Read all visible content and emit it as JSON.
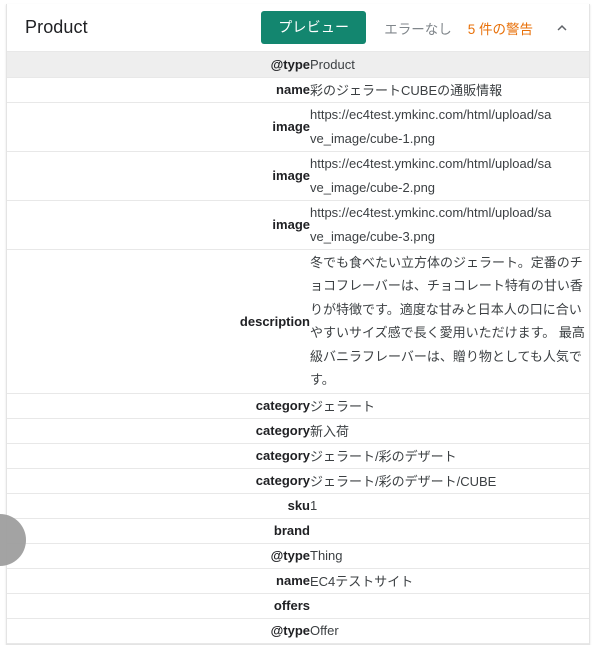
{
  "header": {
    "title": "Product",
    "preview_label": "プレビュー",
    "errors_label": "エラーなし",
    "warnings_label": "5 件の警告",
    "collapse_icon": "chevron-up-icon",
    "accent_color": "#13866f",
    "warning_color": "#e8710a",
    "error_text_color": "#80868b"
  },
  "table": {
    "rows": [
      {
        "key": "@type",
        "level": 1,
        "value": "Product",
        "shaded": true,
        "lines": 1
      },
      {
        "key": "name",
        "level": 1,
        "value": "彩のジェラートCUBEの通販情報",
        "shaded": false,
        "lines": 1
      },
      {
        "key": "image",
        "level": 1,
        "value": "https://ec4test.ymkinc.com/html/upload/save_image/cube-1.png",
        "value_line1": "https://ec4test.ymkinc.com/html/upload/sa",
        "value_line2": "ve_image/cube-1.png",
        "shaded": false,
        "lines": 2
      },
      {
        "key": "image",
        "level": 1,
        "value": "https://ec4test.ymkinc.com/html/upload/save_image/cube-2.png",
        "value_line1": "https://ec4test.ymkinc.com/html/upload/sa",
        "value_line2": "ve_image/cube-2.png",
        "shaded": false,
        "lines": 2
      },
      {
        "key": "image",
        "level": 1,
        "value": "https://ec4test.ymkinc.com/html/upload/save_image/cube-3.png",
        "value_line1": "https://ec4test.ymkinc.com/html/upload/sa",
        "value_line2": "ve_image/cube-3.png",
        "shaded": false,
        "lines": 2
      },
      {
        "key": "description",
        "level": 1,
        "value": "冬でも食べたい立方体のジェラート。定番のチョコフレーバーは、チョコレート特有の甘い香りが特徴です。適度な甘みと日本人の口に合いやすいサイズ感で長く愛用いただけます。 最高級バニラフレーバーは、贈り物としても人気です。",
        "shaded": false,
        "lines": 6
      },
      {
        "key": "category",
        "level": 1,
        "value": "ジェラート",
        "shaded": false,
        "lines": 1
      },
      {
        "key": "category",
        "level": 1,
        "value": "新入荷",
        "shaded": false,
        "lines": 1
      },
      {
        "key": "category",
        "level": 1,
        "value": "ジェラート/彩のデザート",
        "shaded": false,
        "lines": 1
      },
      {
        "key": "category",
        "level": 1,
        "value": "ジェラート/彩のデザート/CUBE",
        "shaded": false,
        "lines": 1
      },
      {
        "key": "sku",
        "level": 1,
        "value": "1",
        "shaded": false,
        "lines": 1
      },
      {
        "key": "brand",
        "level": 1,
        "value": "",
        "shaded": false,
        "lines": 1
      },
      {
        "key": "@type",
        "level": 2,
        "value": "Thing",
        "shaded": false,
        "lines": 1
      },
      {
        "key": "name",
        "level": 2,
        "value": "EC4テストサイト",
        "shaded": false,
        "lines": 1
      },
      {
        "key": "offers",
        "level": 1,
        "value": "",
        "shaded": false,
        "lines": 1
      },
      {
        "key": "@type",
        "level": 2,
        "value": "Offer",
        "shaded": false,
        "lines": 1
      }
    ]
  }
}
